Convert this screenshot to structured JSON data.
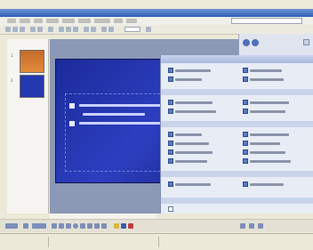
{
  "window": {
    "title": ""
  },
  "menu": [
    "",
    "",
    "",
    "",
    "",
    "",
    "",
    "",
    ""
  ],
  "slide": {
    "title": "",
    "bullets": [
      "",
      "",
      ""
    ]
  },
  "taskpane": {
    "header": "",
    "sections": [
      "",
      "",
      "",
      ""
    ],
    "options": [
      "",
      "",
      "",
      "",
      "",
      "",
      "",
      "",
      "",
      "",
      "",
      "",
      "",
      "",
      "",
      "",
      "",
      ""
    ]
  },
  "status": {
    "left": "",
    "right": ""
  }
}
